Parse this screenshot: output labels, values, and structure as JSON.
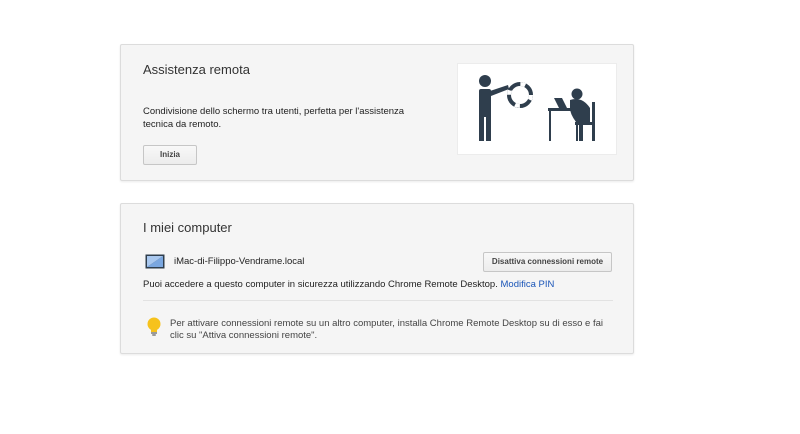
{
  "remote_assistance": {
    "title": "Assistenza remota",
    "description": "Condivisione dello schermo tra utenti, perfetta per l'assistenza tecnica da remoto.",
    "start_button": "Inizia",
    "illustration_icon": "helper-lifebuoy-illustration"
  },
  "my_computers": {
    "title": "I miei computer",
    "computer": {
      "icon": "monitor-icon",
      "name": "iMac-di-Filippo-Vendrame.local",
      "disable_button": "Disattiva connessioni remote"
    },
    "access_text": "Puoi accedere a questo computer in sicurezza utilizzando Chrome Remote Desktop.",
    "change_pin_link": "Modifica PIN",
    "hint": {
      "icon": "lightbulb-icon",
      "text": "Per attivare connessioni remote su un altro computer, installa Chrome Remote Desktop su di esso e fai clic su \"Attiva connessioni remote\"."
    }
  },
  "colors": {
    "card_background": "#f5f5f5",
    "link": "#1a55b8",
    "icon_dark": "#2f3e4d",
    "bulb": "#f6c21c"
  }
}
